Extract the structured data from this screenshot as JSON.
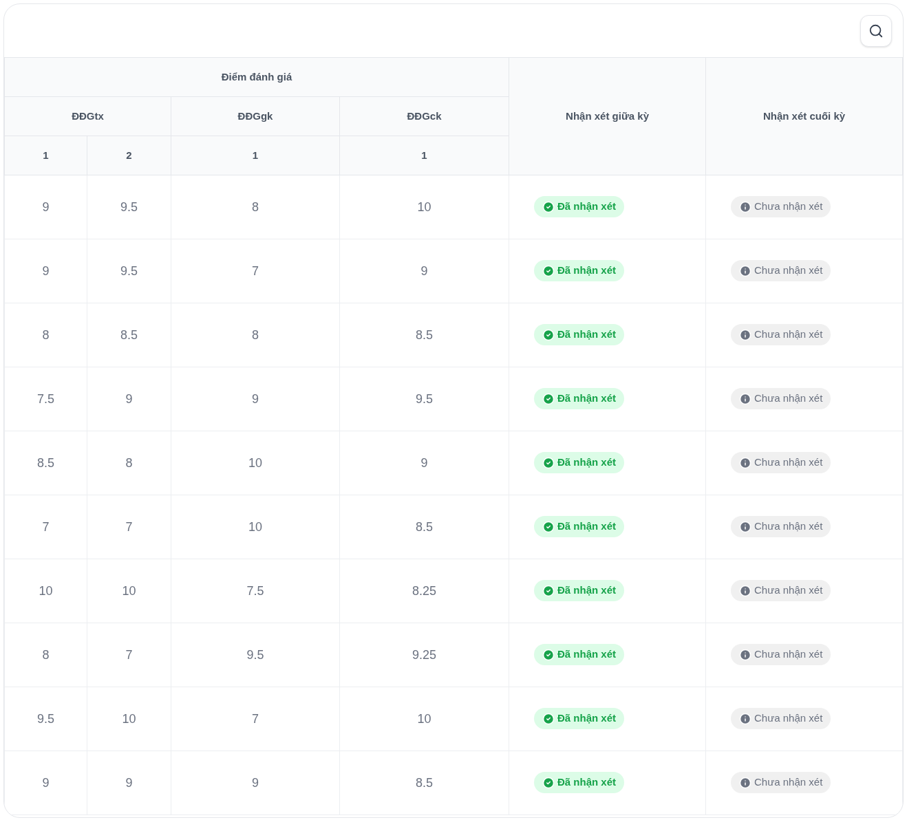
{
  "table": {
    "group_header": "Điểm đánh giá",
    "groups": [
      {
        "label": "ĐĐGtx",
        "columns": [
          "1",
          "2"
        ]
      },
      {
        "label": "ĐĐGgk",
        "columns": [
          "1"
        ]
      },
      {
        "label": "ĐĐGck",
        "columns": [
          "1"
        ]
      }
    ],
    "comment_columns": [
      "Nhận xét giữa kỳ",
      "Nhận xét cuối kỳ"
    ],
    "rows": [
      {
        "scores": [
          "9",
          "9.5",
          "8",
          "10"
        ],
        "comments": [
          {
            "kind": "done",
            "label": "Đã nhận xét"
          },
          {
            "kind": "pending",
            "label": "Chưa nhận xét"
          }
        ]
      },
      {
        "scores": [
          "9",
          "9.5",
          "7",
          "9"
        ],
        "comments": [
          {
            "kind": "done",
            "label": "Đã nhận xét"
          },
          {
            "kind": "pending",
            "label": "Chưa nhận xét"
          }
        ]
      },
      {
        "scores": [
          "8",
          "8.5",
          "8",
          "8.5"
        ],
        "comments": [
          {
            "kind": "done",
            "label": "Đã nhận xét"
          },
          {
            "kind": "pending",
            "label": "Chưa nhận xét"
          }
        ]
      },
      {
        "scores": [
          "7.5",
          "9",
          "9",
          "9.5"
        ],
        "comments": [
          {
            "kind": "done",
            "label": "Đã nhận xét"
          },
          {
            "kind": "pending",
            "label": "Chưa nhận xét"
          }
        ]
      },
      {
        "scores": [
          "8.5",
          "8",
          "10",
          "9"
        ],
        "comments": [
          {
            "kind": "done",
            "label": "Đã nhận xét"
          },
          {
            "kind": "pending",
            "label": "Chưa nhận xét"
          }
        ]
      },
      {
        "scores": [
          "7",
          "7",
          "10",
          "8.5"
        ],
        "comments": [
          {
            "kind": "done",
            "label": "Đã nhận xét"
          },
          {
            "kind": "pending",
            "label": "Chưa nhận xét"
          }
        ]
      },
      {
        "scores": [
          "10",
          "10",
          "7.5",
          "8.25"
        ],
        "comments": [
          {
            "kind": "done",
            "label": "Đã nhận xét"
          },
          {
            "kind": "pending",
            "label": "Chưa nhận xét"
          }
        ]
      },
      {
        "scores": [
          "8",
          "7",
          "9.5",
          "9.25"
        ],
        "comments": [
          {
            "kind": "done",
            "label": "Đã nhận xét"
          },
          {
            "kind": "pending",
            "label": "Chưa nhận xét"
          }
        ]
      },
      {
        "scores": [
          "9.5",
          "10",
          "7",
          "10"
        ],
        "comments": [
          {
            "kind": "done",
            "label": "Đã nhận xét"
          },
          {
            "kind": "pending",
            "label": "Chưa nhận xét"
          }
        ]
      },
      {
        "scores": [
          "9",
          "9",
          "9",
          "8.5"
        ],
        "comments": [
          {
            "kind": "done",
            "label": "Đã nhận xét"
          },
          {
            "kind": "pending",
            "label": "Chưa nhận xét"
          }
        ]
      }
    ]
  }
}
